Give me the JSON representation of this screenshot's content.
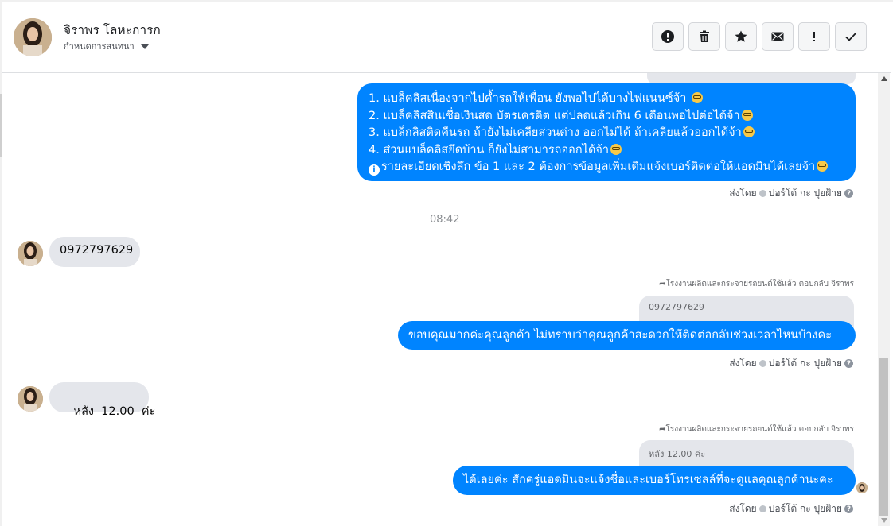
{
  "header": {
    "contact_name": "จิราพร โลหะการก",
    "status_label": "กำหนดการสนทนา",
    "toolbar": [
      {
        "name": "report-button",
        "icon": "alert-circle-icon"
      },
      {
        "name": "delete-button",
        "icon": "trash-icon"
      },
      {
        "name": "star-button",
        "icon": "star-icon"
      },
      {
        "name": "mark-unread-button",
        "icon": "envelope-icon"
      },
      {
        "name": "important-button",
        "icon": "exclamation-icon"
      },
      {
        "name": "done-button",
        "icon": "check-icon"
      }
    ]
  },
  "conversation": {
    "first_message": {
      "lines": [
        "1. แบล็คลิสเนื่องจากไปค้ำรถให้เพื่อน ยังพอไปได้บางไฟแนนซ์จ้า",
        "2. แบล็คลิสสินเชื่อเงินสด บัตรเครดิต แต่ปลดแล้วเกิน 6 เดือนพอไปต่อได้จ้า",
        "3. แบล็กลิสติดคืนรถ ถ้ายังไม่เคลียส่วนต่าง ออกไม่ได้ ถ้าเคลียแล้วออกได้จ้า",
        "4. ส่วนแบล็คลิสยึดบ้าน ก็ยังไม่สามารถออกได้จ้า",
        "รายละเอียดเชิงลึก ข้อ 1 และ 2 ต้องการข้อมูลเพิ่มเติมแจ้งเบอร์ติดต่อให้แอดมินได้เลยจ้า"
      ],
      "sent_by": "ส่งโดย",
      "sender": "ปอร์โต้ กะ ปุยฝ้าย"
    },
    "timestamp": "08:42",
    "incoming_1": "0972797629",
    "reply_1": {
      "reply_note": "โรงงานผลิตและกระจายรถยนต์ใช้แล้ว ตอบกลับ จิราพร",
      "quoted": "0972797629",
      "text": "ขอบคุณมากค่ะคุณลูกค้า ไม่ทราบว่าคุณลูกค้าสะดวกให้ติดต่อกลับช่วงเวลาไหนบ้างคะ",
      "sent_by": "ส่งโดย",
      "sender": "ปอร์โต้ กะ ปุยฝ้าย"
    },
    "incoming_2": "หลัง  12.00  ค่ะ",
    "reply_2": {
      "reply_note": "โรงงานผลิตและกระจายรถยนต์ใช้แล้ว ตอบกลับ จิราพร",
      "quoted": "หลัง 12.00 ค่ะ",
      "text": "ได้เลยค่ะ สักครู่แอดมินจะแจ้งชื่อและเบอร์โทรเซลล์ที่จะดูแลคุณลูกค้านะคะ",
      "sent_by": "ส่งโดย",
      "sender": "ปอร์โต้ กะ ปุยฝ้าย"
    }
  },
  "colors": {
    "outgoing_bubble": "#0084ff",
    "incoming_bubble": "#e4e6eb"
  }
}
